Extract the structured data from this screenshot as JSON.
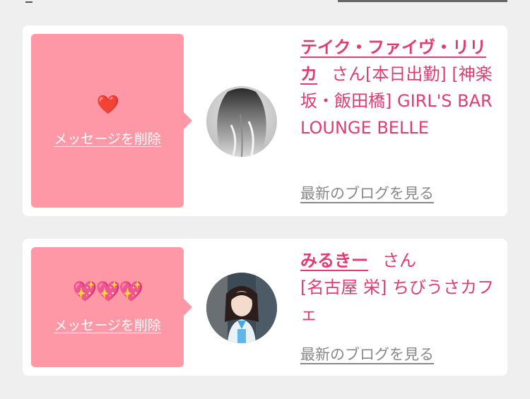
{
  "cards": [
    {
      "reaction_emoji": "❤️",
      "delete_label": "メッセージを削除",
      "name": "テイク・ファイヴ・リリカ",
      "honorific": "さん",
      "detail": "[本日出勤] [神楽坂・飯田橋] GIRL'S BAR LOUNGE BELLE",
      "blog_label": "最新のブログを見る"
    },
    {
      "reaction_emoji": "💖💖💖",
      "delete_label": "メッセージを削除",
      "name": "みるきー",
      "honorific": "さん",
      "detail": "[名古屋 栄] ちびうさカフェ",
      "blog_label": "最新のブログを見る"
    }
  ],
  "colors": {
    "accent": "#e13c70",
    "message_box": "#fe98a6",
    "link_gray": "#888888",
    "background": "#efefef"
  }
}
